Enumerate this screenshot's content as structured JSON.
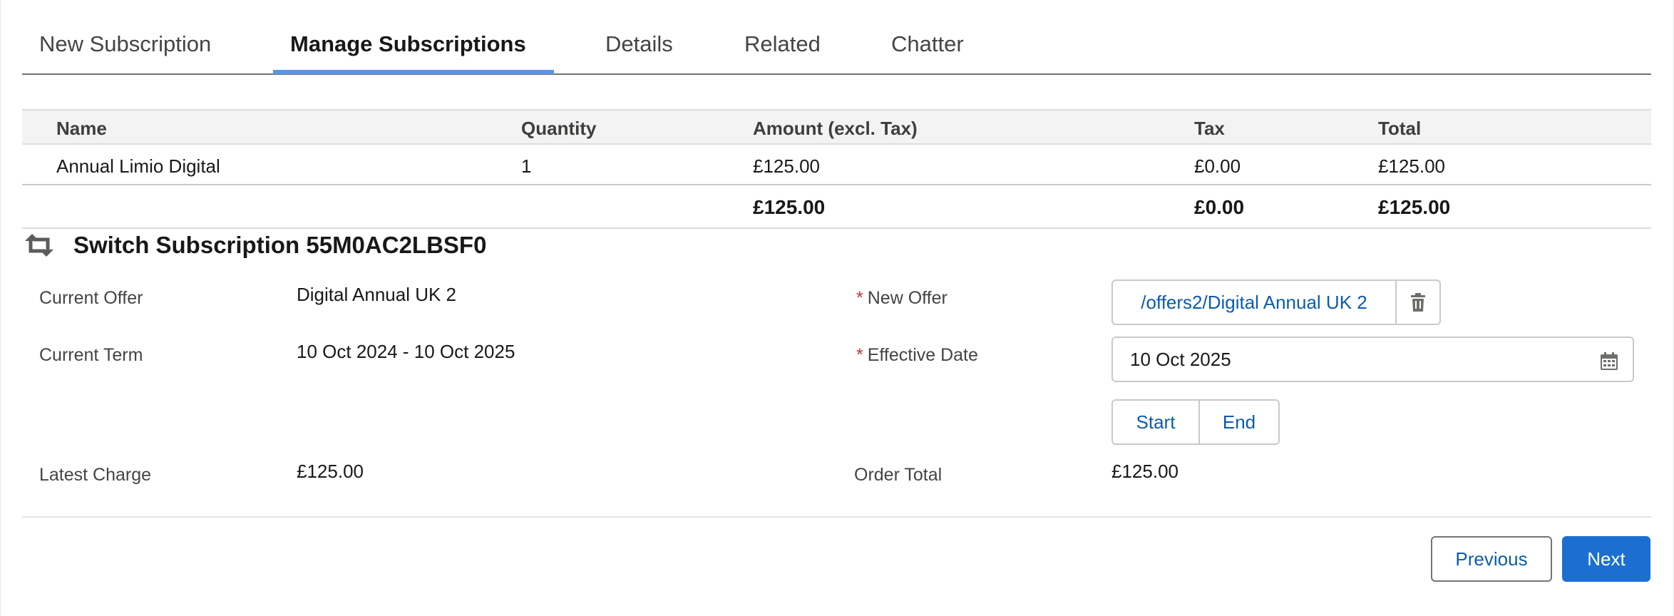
{
  "tabs": [
    {
      "label": "New Subscription"
    },
    {
      "label": "Manage Subscriptions",
      "active": true
    },
    {
      "label": "Details"
    },
    {
      "label": "Related"
    },
    {
      "label": "Chatter"
    }
  ],
  "table": {
    "headers": {
      "name": "Name",
      "quantity": "Quantity",
      "amount": "Amount (excl. Tax)",
      "tax": "Tax",
      "total": "Total"
    },
    "rows": [
      {
        "name": "Annual Limio Digital",
        "quantity": "1",
        "amount": "£125.00",
        "tax": "£0.00",
        "total": "£125.00"
      }
    ],
    "totals": {
      "amount": "£125.00",
      "tax": "£0.00",
      "total": "£125.00"
    }
  },
  "section": {
    "icon": "switch-icon",
    "title": "Switch Subscription 55M0AC2LBSF0"
  },
  "form": {
    "current_offer": {
      "label": "Current Offer",
      "value": "Digital Annual UK 2"
    },
    "current_term": {
      "label": "Current Term",
      "value": "10 Oct 2024 - 10 Oct 2025"
    },
    "latest_charge": {
      "label": "Latest Charge",
      "value": "£125.00"
    },
    "new_offer": {
      "label": "New Offer",
      "required_mark": "*",
      "value": "/offers2/Digital Annual UK 2"
    },
    "effective_date": {
      "label": "Effective Date",
      "required_mark": "*",
      "value": "10 Oct 2025"
    },
    "date_shortcuts": {
      "start": "Start",
      "end": "End"
    },
    "order_total": {
      "label": "Order Total",
      "value": "£125.00"
    }
  },
  "footer": {
    "previous": "Previous",
    "next": "Next"
  },
  "colors": {
    "accent": "#1b6fd1",
    "link": "#0b5cab",
    "tab_underline": "#5b95e8",
    "required": "#c23934"
  }
}
